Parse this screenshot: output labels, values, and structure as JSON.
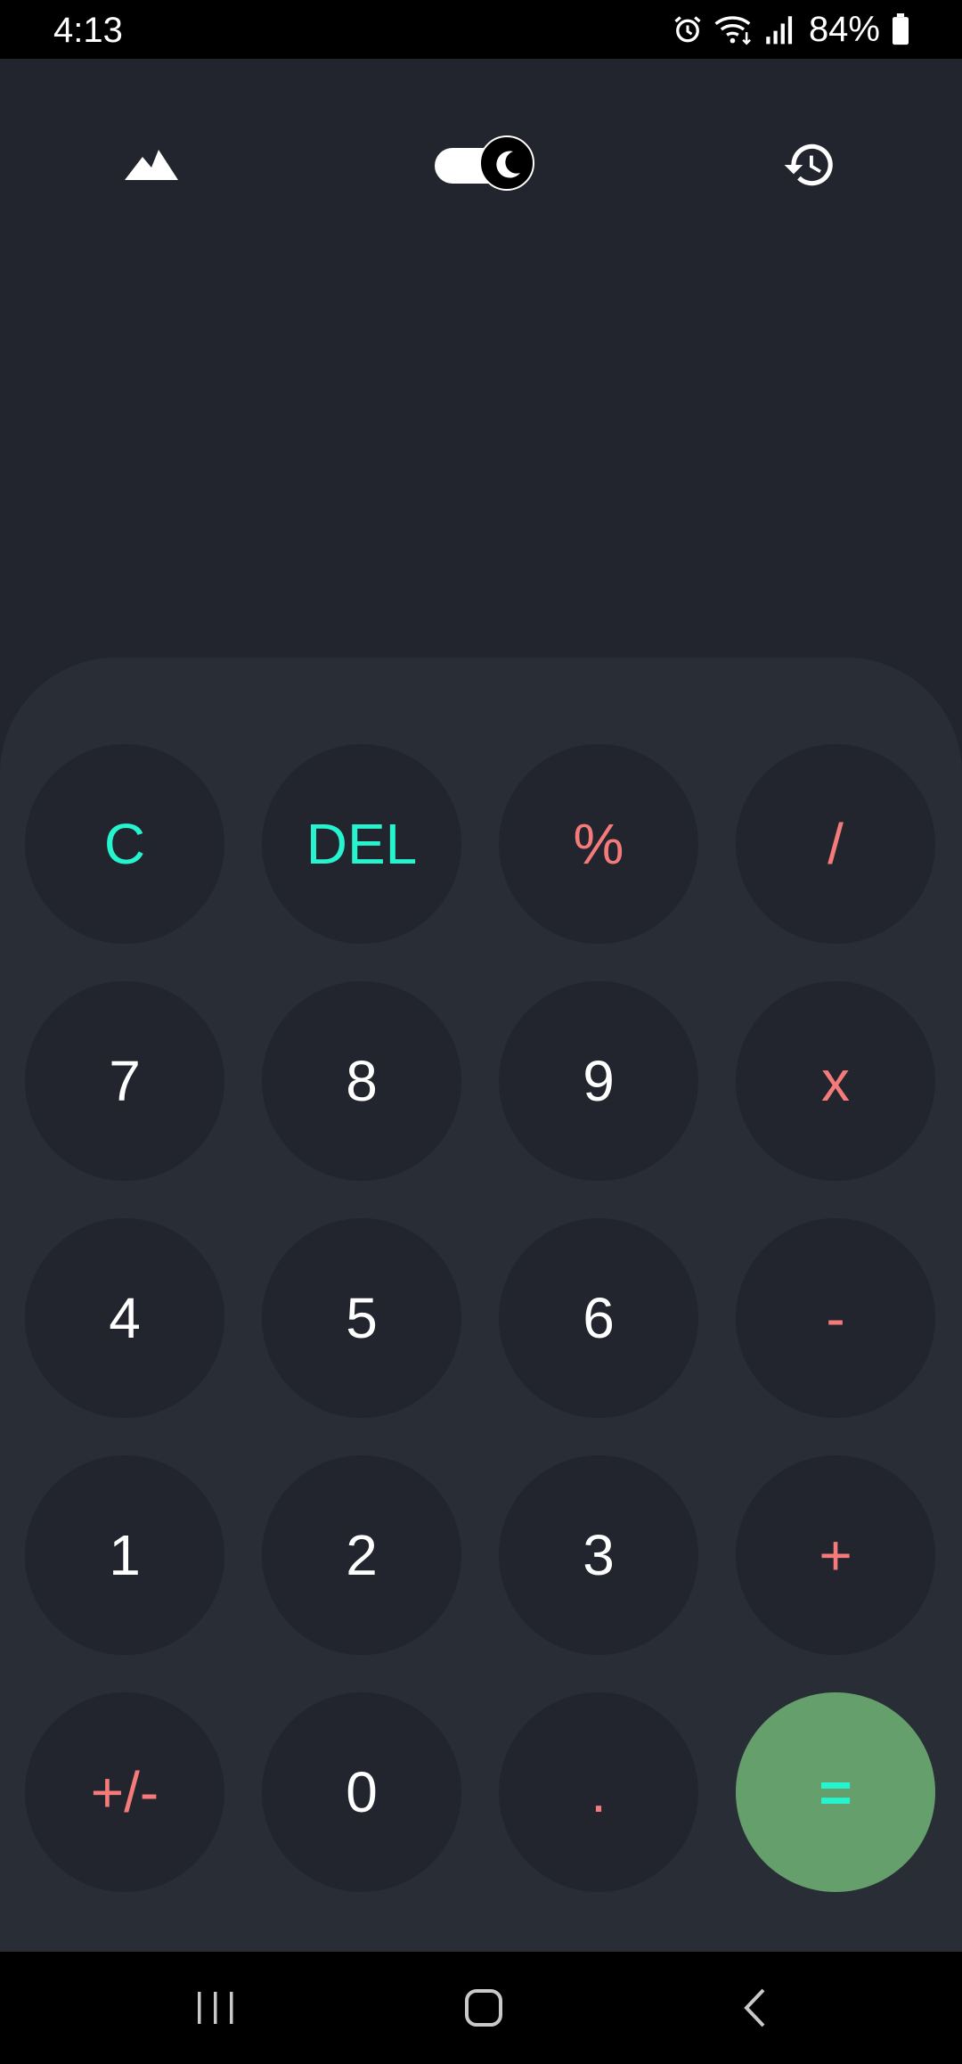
{
  "status_bar": {
    "time": "4:13",
    "battery_percent": "84%",
    "icons": [
      "alarm-icon",
      "wifi-icon",
      "signal-icon",
      "battery-icon"
    ]
  },
  "top_bar": {
    "left_icon": "mountain-icon",
    "toggle_icon": "moon-icon",
    "toggle_state": "dark",
    "right_icon": "history-icon"
  },
  "display": {
    "expression": "",
    "result": ""
  },
  "keypad": {
    "rows": [
      [
        {
          "label": "C",
          "style": "accent",
          "name": "clear"
        },
        {
          "label": "DEL",
          "style": "accent",
          "name": "delete"
        },
        {
          "label": "%",
          "style": "op",
          "name": "percent"
        },
        {
          "label": "/",
          "style": "op",
          "name": "divide"
        }
      ],
      [
        {
          "label": "7",
          "style": "num",
          "name": "7"
        },
        {
          "label": "8",
          "style": "num",
          "name": "8"
        },
        {
          "label": "9",
          "style": "num",
          "name": "9"
        },
        {
          "label": "x",
          "style": "op",
          "name": "multiply"
        }
      ],
      [
        {
          "label": "4",
          "style": "num",
          "name": "4"
        },
        {
          "label": "5",
          "style": "num",
          "name": "5"
        },
        {
          "label": "6",
          "style": "num",
          "name": "6"
        },
        {
          "label": "-",
          "style": "op",
          "name": "subtract"
        }
      ],
      [
        {
          "label": "1",
          "style": "num",
          "name": "1"
        },
        {
          "label": "2",
          "style": "num",
          "name": "2"
        },
        {
          "label": "3",
          "style": "num",
          "name": "3"
        },
        {
          "label": "+",
          "style": "op",
          "name": "add"
        }
      ],
      [
        {
          "label": "+/-",
          "style": "op",
          "name": "negate"
        },
        {
          "label": "0",
          "style": "num",
          "name": "0"
        },
        {
          "label": ".",
          "style": "op",
          "name": "decimal"
        },
        {
          "label": "=",
          "style": "equals",
          "name": "equals"
        }
      ]
    ]
  },
  "nav_bar": {
    "icons": [
      "recent-apps-icon",
      "home-icon",
      "back-icon"
    ]
  },
  "colors": {
    "background": "#22252d",
    "keypad_panel": "#292d36",
    "key": "#22252d",
    "accent": "#26f4ce",
    "operator": "#f57b7b",
    "equals": "#659f6b",
    "text": "#ffffff"
  }
}
